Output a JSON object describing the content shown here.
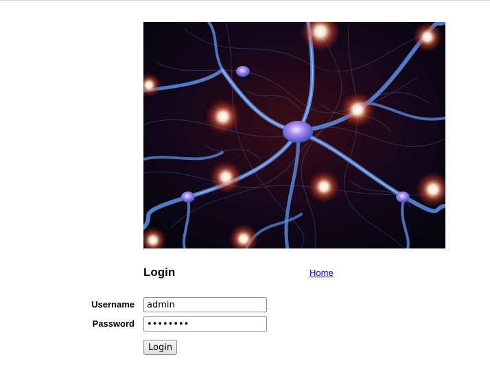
{
  "hero": {
    "image_name": "neuron-network-image",
    "colors": {
      "axon": "#5a8fe6",
      "glow": "#fff3e0",
      "halo": "#c8321e",
      "background": "#05060f"
    }
  },
  "login": {
    "title": "Login",
    "home_link": "Home",
    "username_label": "Username",
    "password_label": "Password",
    "username_value": "admin",
    "password_value": "••••••••",
    "submit_label": "Login"
  }
}
